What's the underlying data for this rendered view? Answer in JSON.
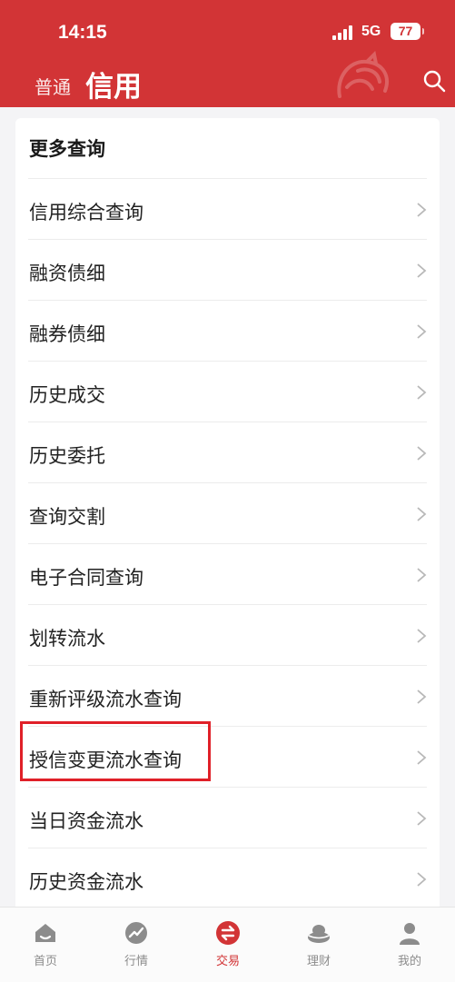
{
  "status_bar": {
    "time": "14:15",
    "network": "5G",
    "battery": "77"
  },
  "header": {
    "tab_normal": "普通",
    "tab_credit": "信用",
    "background_color": "#d23436"
  },
  "card": {
    "title": "更多查询",
    "items": [
      {
        "label": "信用综合查询"
      },
      {
        "label": "融资债细"
      },
      {
        "label": "融券债细"
      },
      {
        "label": "历史成交"
      },
      {
        "label": "历史委托"
      },
      {
        "label": "查询交割"
      },
      {
        "label": "电子合同查询"
      },
      {
        "label": "划转流水"
      },
      {
        "label": "重新评级流水查询"
      },
      {
        "label": "授信变更流水查询",
        "highlighted": true
      },
      {
        "label": "当日资金流水"
      },
      {
        "label": "历史资金流水"
      }
    ],
    "highlight_color": "#e02028"
  },
  "bottom_nav": {
    "active_color": "#d23436",
    "inactive_color": "#8c8c8c",
    "items": [
      {
        "label": "首页",
        "icon": "home-icon"
      },
      {
        "label": "行情",
        "icon": "market-trend-icon"
      },
      {
        "label": "交易",
        "icon": "trade-exchange-icon",
        "active": true
      },
      {
        "label": "理财",
        "icon": "wealth-ingot-icon"
      },
      {
        "label": "我的",
        "icon": "profile-icon"
      }
    ]
  }
}
